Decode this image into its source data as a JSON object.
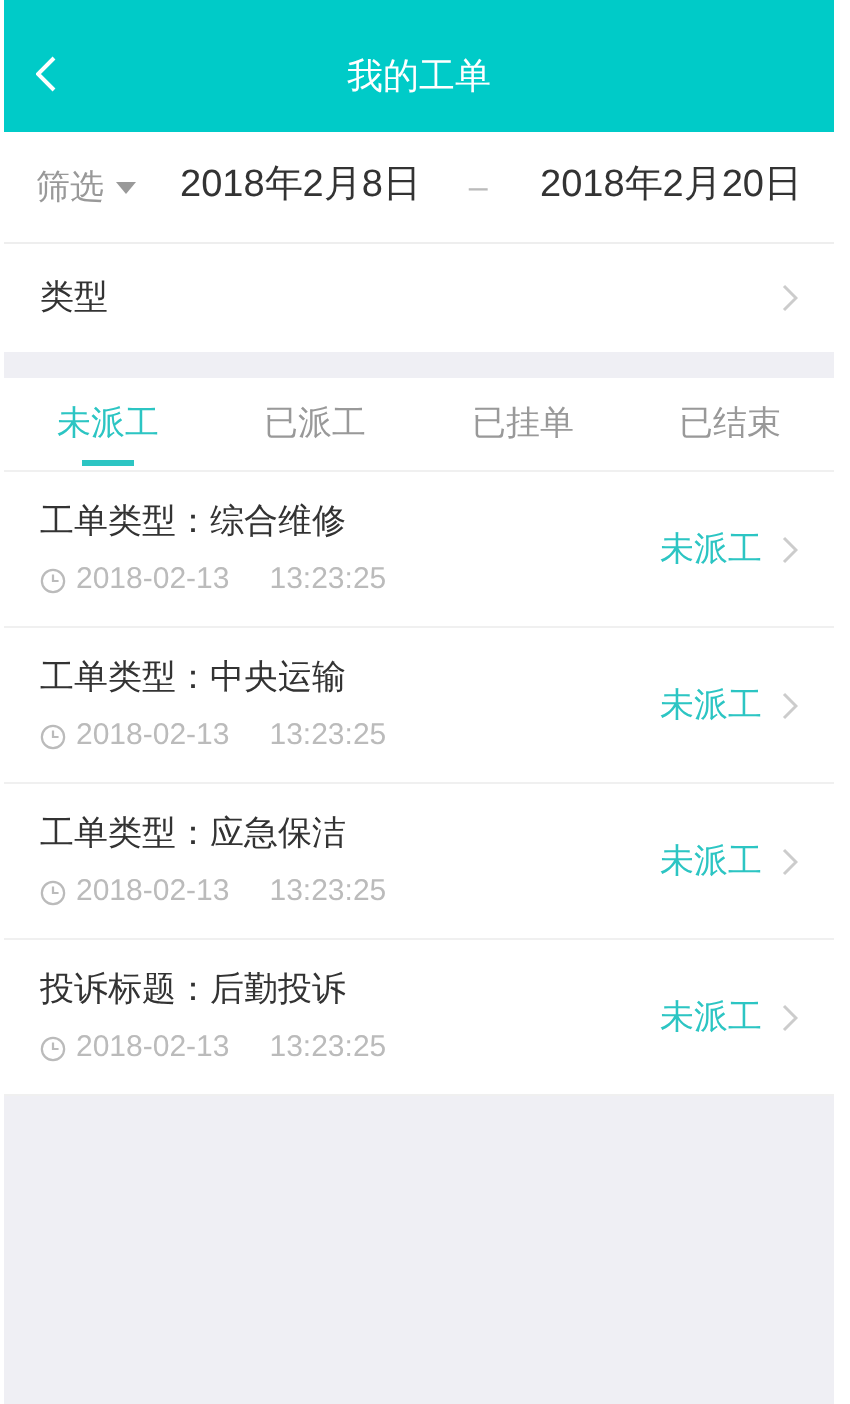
{
  "header": {
    "title": "我的工单"
  },
  "filter": {
    "label": "筛选",
    "start_date": "2018年2月8日",
    "separator": "–",
    "end_date": "2018年2月20日"
  },
  "type_row": {
    "label": "类型"
  },
  "tabs": [
    {
      "label": "未派工",
      "selected": true
    },
    {
      "label": "已派工",
      "selected": false
    },
    {
      "label": "已挂单",
      "selected": false
    },
    {
      "label": "已结束",
      "selected": false
    }
  ],
  "orders": [
    {
      "title": "工单类型：综合维修",
      "date": "2018-02-13",
      "time": "13:23:25",
      "status": "未派工"
    },
    {
      "title": "工单类型：中央运输",
      "date": "2018-02-13",
      "time": "13:23:25",
      "status": "未派工"
    },
    {
      "title": "工单类型：应急保洁",
      "date": "2018-02-13",
      "time": "13:23:25",
      "status": "未派工"
    },
    {
      "title": "投诉标题：后勤投诉",
      "date": "2018-02-13",
      "time": "13:23:25",
      "status": "未派工"
    }
  ]
}
